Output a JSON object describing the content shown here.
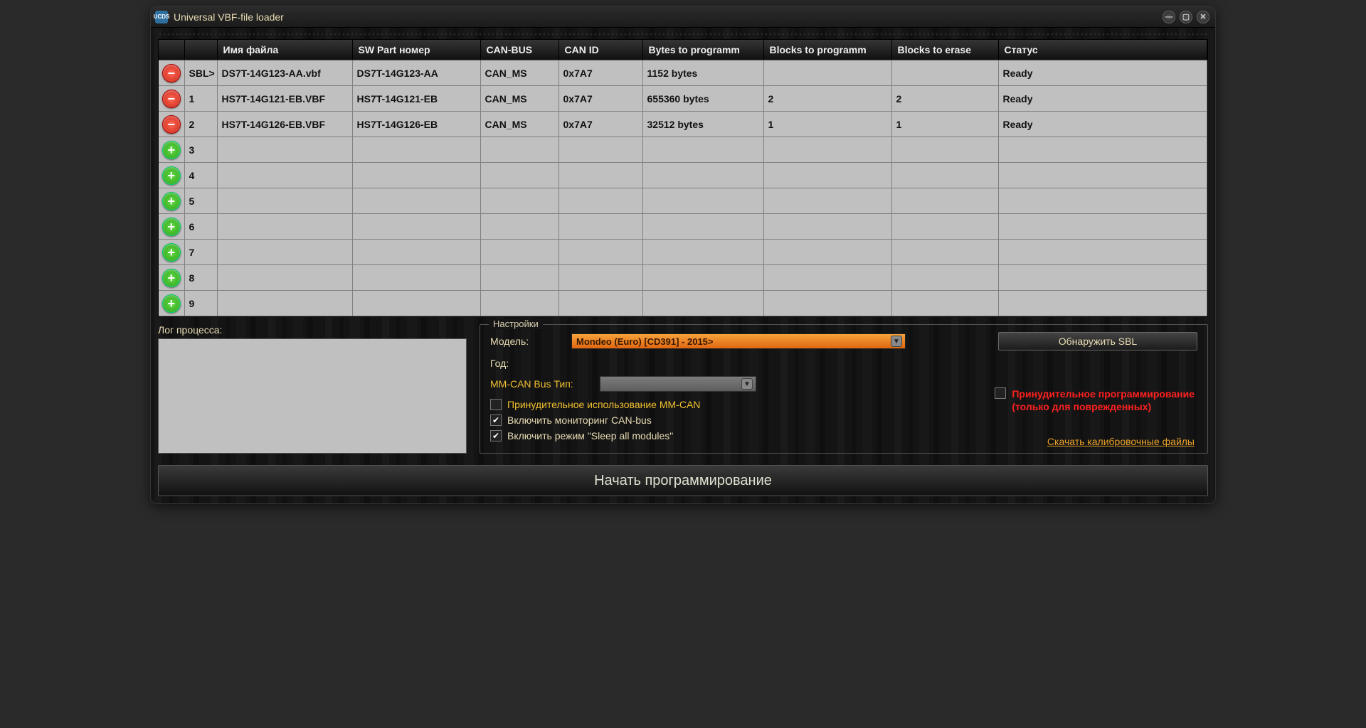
{
  "window": {
    "title": "Universal VBF-file loader",
    "logo": "UCDS"
  },
  "columns": {
    "c0": "",
    "c1": "",
    "c2": "Имя файла",
    "c3": "SW Part номер",
    "c4": "CAN-BUS",
    "c5": "CAN ID",
    "c6": "Bytes to programm",
    "c7": "Blocks to programm",
    "c8": "Blocks to erase",
    "c9": "Статус"
  },
  "rows": [
    {
      "action": "remove",
      "slot": "SBL>",
      "file": "DS7T-14G123-AA.vbf",
      "sw": "DS7T-14G123-AA",
      "bus": "CAN_MS",
      "id": "0x7A7",
      "bytes": "1152 bytes",
      "blocks": "",
      "erase": "",
      "status": "Ready"
    },
    {
      "action": "remove",
      "slot": "1",
      "file": "HS7T-14G121-EB.VBF",
      "sw": "HS7T-14G121-EB",
      "bus": "CAN_MS",
      "id": "0x7A7",
      "bytes": "655360 bytes",
      "blocks": "2",
      "erase": "2",
      "status": "Ready"
    },
    {
      "action": "remove",
      "slot": "2",
      "file": "HS7T-14G126-EB.VBF",
      "sw": "HS7T-14G126-EB",
      "bus": "CAN_MS",
      "id": "0x7A7",
      "bytes": "32512 bytes",
      "blocks": "1",
      "erase": "1",
      "status": "Ready"
    },
    {
      "action": "add",
      "slot": "3",
      "file": "",
      "sw": "",
      "bus": "",
      "id": "",
      "bytes": "",
      "blocks": "",
      "erase": "",
      "status": ""
    },
    {
      "action": "add",
      "slot": "4",
      "file": "",
      "sw": "",
      "bus": "",
      "id": "",
      "bytes": "",
      "blocks": "",
      "erase": "",
      "status": ""
    },
    {
      "action": "add",
      "slot": "5",
      "file": "",
      "sw": "",
      "bus": "",
      "id": "",
      "bytes": "",
      "blocks": "",
      "erase": "",
      "status": ""
    },
    {
      "action": "add",
      "slot": "6",
      "file": "",
      "sw": "",
      "bus": "",
      "id": "",
      "bytes": "",
      "blocks": "",
      "erase": "",
      "status": ""
    },
    {
      "action": "add",
      "slot": "7",
      "file": "",
      "sw": "",
      "bus": "",
      "id": "",
      "bytes": "",
      "blocks": "",
      "erase": "",
      "status": ""
    },
    {
      "action": "add",
      "slot": "8",
      "file": "",
      "sw": "",
      "bus": "",
      "id": "",
      "bytes": "",
      "blocks": "",
      "erase": "",
      "status": ""
    },
    {
      "action": "add",
      "slot": "9",
      "file": "",
      "sw": "",
      "bus": "",
      "id": "",
      "bytes": "",
      "blocks": "",
      "erase": "",
      "status": ""
    }
  ],
  "log": {
    "label": "Лог процесса:"
  },
  "settings": {
    "legend": "Настройки",
    "model_label": "Модель:",
    "model_value": "Mondeo (Euro) [CD391] - 2015>",
    "year_label": "Год:",
    "mmcan_label": "MM-CAN Bus Тип:",
    "force_mmcan": "Принудительное использование MM-CAN",
    "monitor": "Включить мониторинг CAN-bus",
    "sleep": "Включить режим \"Sleep all modules\"",
    "detect_sbl": "Обнаружить SBL",
    "force_prog": "Принудительное программирование\n(только для поврежденных)",
    "download_link": "Скачать калибровочные файлы"
  },
  "start": "Начать программирование"
}
